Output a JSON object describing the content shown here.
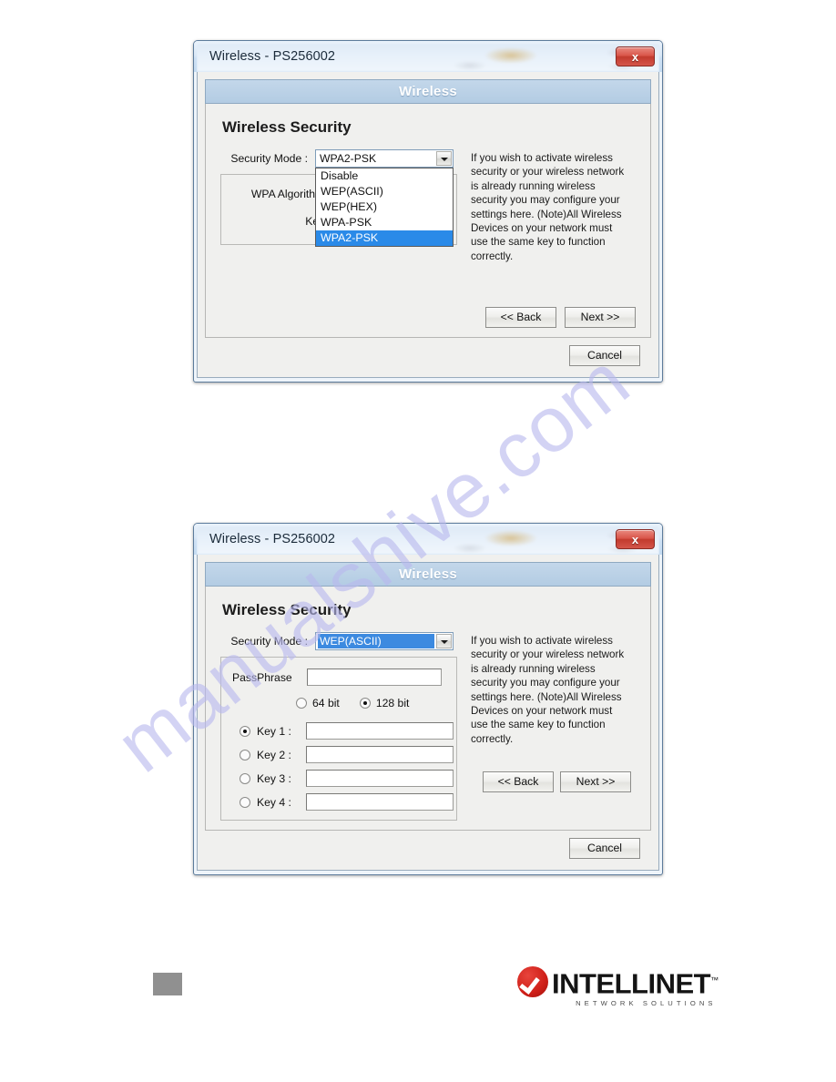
{
  "page": {
    "watermark": "manualshive.com",
    "page_marker": ""
  },
  "dialog1": {
    "titlebar": {
      "title": "Wireless - PS256002",
      "close_label": "x"
    },
    "band_title": "Wireless",
    "panel_title": "Wireless Security",
    "security_mode_label": "Security Mode :",
    "security_mode_value": "WPA2-PSK",
    "dropdown_open": true,
    "dropdown_options": [
      {
        "label": "Disable",
        "selected": false
      },
      {
        "label": "WEP(ASCII)",
        "selected": false
      },
      {
        "label": "WEP(HEX)",
        "selected": false
      },
      {
        "label": "WPA-PSK",
        "selected": false
      },
      {
        "label": "WPA2-PSK",
        "selected": true
      }
    ],
    "wpa_algorithm_label": "WPA Algorithm :",
    "key_label": "Key :",
    "key_value": "",
    "help_text": "If you wish to activate wireless security or your wireless network is already running wireless security you may configure your settings here. (Note)All Wireless Devices on your network must use the same key to function correctly.",
    "back_label": "<< Back",
    "next_label": "Next >>",
    "cancel_label": "Cancel"
  },
  "dialog2": {
    "titlebar": {
      "title": "Wireless - PS256002",
      "close_label": "x"
    },
    "band_title": "Wireless",
    "panel_title": "Wireless Security",
    "security_mode_label": "Security Mode :",
    "security_mode_value": "WEP(ASCII)",
    "security_mode_highlighted": true,
    "passphrase_label": "PassPhrase",
    "passphrase_value": "",
    "bit_options": [
      {
        "label": "64 bit",
        "selected": false
      },
      {
        "label": "128 bit",
        "selected": true
      }
    ],
    "keys": [
      {
        "label": "Key 1 :",
        "value": "",
        "selected": true
      },
      {
        "label": "Key 2 :",
        "value": "",
        "selected": false
      },
      {
        "label": "Key 3 :",
        "value": "",
        "selected": false
      },
      {
        "label": "Key 4 :",
        "value": "",
        "selected": false
      }
    ],
    "help_text": "If you wish to activate wireless security or your wireless network is already running wireless security you may configure your settings here. (Note)All Wireless Devices on your network must use the same key to function correctly.",
    "back_label": "<< Back",
    "next_label": "Next >>",
    "cancel_label": "Cancel"
  },
  "footer": {
    "brand": "INTELLINET",
    "tagline": "NETWORK SOLUTIONS",
    "trademark": "™"
  },
  "colors": {
    "band": "#b7d0e6",
    "close_red": "#c23b2e",
    "highlight_blue": "#2a8ae8",
    "brand_red": "#cf1f18"
  }
}
